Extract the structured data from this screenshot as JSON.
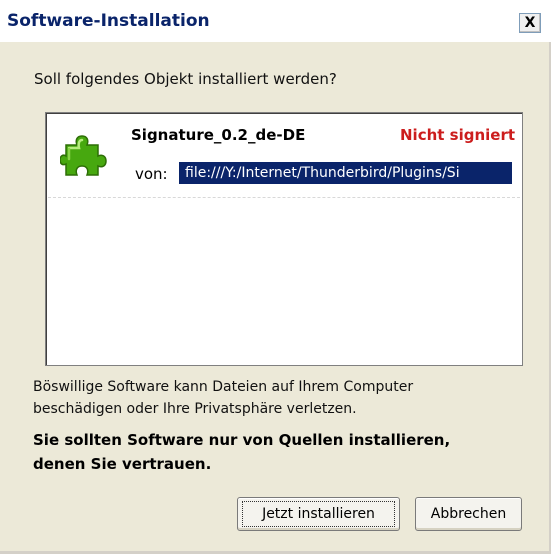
{
  "window": {
    "title": "Software-Installation",
    "close_label": "X"
  },
  "question": "Soll folgendes Objekt installiert werden?",
  "item": {
    "name": "Signature_0.2_de-DE",
    "status": "Nicht signiert",
    "from_label": "von:",
    "url": "file:///Y:/Internet/Thunderbird/Plugins/Si",
    "icon": "puzzle-piece-icon"
  },
  "warning_lines": [
    "Böswillige Software kann Dateien auf Ihrem Computer",
    "beschädigen oder Ihre Privatsphäre verletzen."
  ],
  "strong_warning_lines": [
    "Sie sollten Software nur von Quellen installieren,",
    "denen Sie vertrauen."
  ],
  "buttons": {
    "install": "Jetzt installieren",
    "cancel": "Abbrechen"
  },
  "colors": {
    "title": "#0a246a",
    "status": "#cc1d1d",
    "selection": "#0a246a",
    "icon": "#47a80f"
  }
}
